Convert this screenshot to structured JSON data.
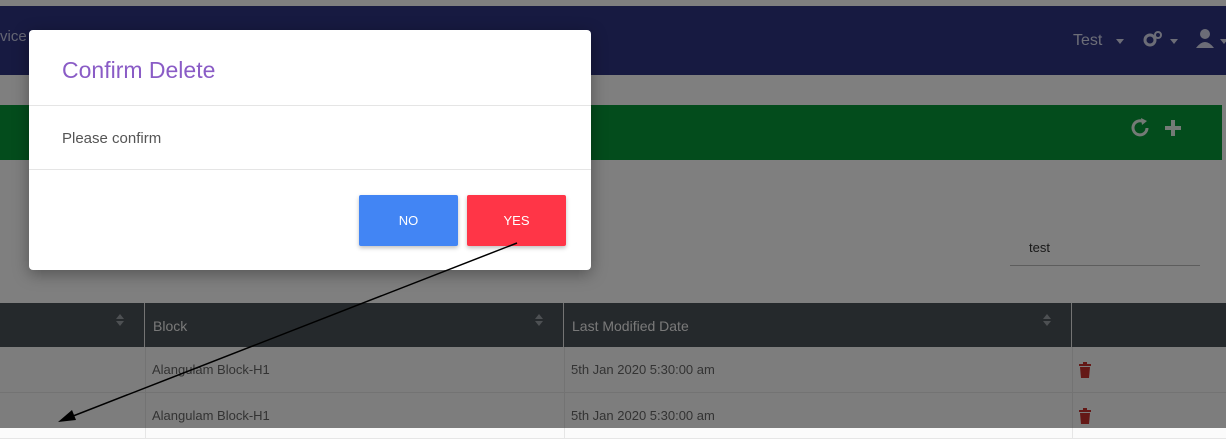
{
  "navbar": {
    "brand_partial": "vice",
    "title_partial": "…",
    "user_label": "Test",
    "bg_color": "#2e3582"
  },
  "toolbar": {
    "refresh_icon": "refresh-icon",
    "add_icon": "plus-icon",
    "bg_color": "#079838"
  },
  "filter": {
    "value": "test"
  },
  "table": {
    "columns": [
      "",
      "Block",
      "Last Modified Date",
      ""
    ],
    "rows": [
      {
        "block": "Alangulam Block-H1",
        "date": "5th Jan 2020 5:30:00 am",
        "action_icon": "trash-icon"
      },
      {
        "block": "Alangulam Block-H1",
        "date": "5th Jan 2020 5:30:00 am",
        "action_icon": "trash-icon"
      }
    ]
  },
  "modal": {
    "title": "Confirm Delete",
    "body": "Please confirm",
    "no_label": "NO",
    "yes_label": "YES",
    "no_color": "#4285f4",
    "yes_color": "#ff3547"
  }
}
